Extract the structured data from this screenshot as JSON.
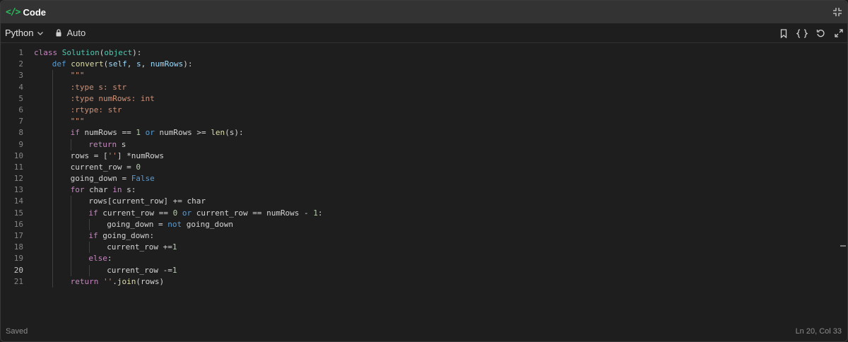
{
  "header": {
    "title": "Code",
    "icon": "code-icon",
    "collapse_icon": "collapse-icon"
  },
  "toolbar": {
    "language": "Python",
    "mode": "Auto",
    "icons": [
      "bookmark-icon",
      "format-braces-icon",
      "reset-icon",
      "expand-icon"
    ]
  },
  "editor": {
    "active_line": 20,
    "lines": [
      {
        "n": "1",
        "indent": 0,
        "tokens": [
          [
            "kw",
            "class"
          ],
          [
            "op",
            " "
          ],
          [
            "cls",
            "Solution"
          ],
          [
            "op",
            "("
          ],
          [
            "cls",
            "object"
          ],
          [
            "op",
            "):"
          ]
        ]
      },
      {
        "n": "2",
        "indent": 1,
        "tokens": [
          [
            "bl",
            "def"
          ],
          [
            "op",
            " "
          ],
          [
            "fn",
            "convert"
          ],
          [
            "op",
            "("
          ],
          [
            "pm",
            "self"
          ],
          [
            "op",
            ", "
          ],
          [
            "pm",
            "s"
          ],
          [
            "op",
            ", "
          ],
          [
            "pm",
            "numRows"
          ],
          [
            "op",
            "):"
          ]
        ]
      },
      {
        "n": "3",
        "indent": 2,
        "tokens": [
          [
            "st",
            "\"\"\""
          ]
        ]
      },
      {
        "n": "4",
        "indent": 2,
        "tokens": [
          [
            "st",
            ":type s: str"
          ]
        ]
      },
      {
        "n": "5",
        "indent": 2,
        "tokens": [
          [
            "st",
            ":type numRows: int"
          ]
        ]
      },
      {
        "n": "6",
        "indent": 2,
        "tokens": [
          [
            "st",
            ":rtype: str"
          ]
        ]
      },
      {
        "n": "7",
        "indent": 2,
        "tokens": [
          [
            "st",
            "\"\"\""
          ]
        ]
      },
      {
        "n": "8",
        "indent": 2,
        "tokens": [
          [
            "kw",
            "if"
          ],
          [
            "op",
            " numRows == "
          ],
          [
            "num",
            "1"
          ],
          [
            "op",
            " "
          ],
          [
            "bl",
            "or"
          ],
          [
            "op",
            " numRows >= "
          ],
          [
            "fn",
            "len"
          ],
          [
            "op",
            "(s):"
          ]
        ]
      },
      {
        "n": "9",
        "indent": 3,
        "tokens": [
          [
            "kw",
            "return"
          ],
          [
            "op",
            " s"
          ]
        ]
      },
      {
        "n": "10",
        "indent": 2,
        "tokens": [
          [
            "op",
            "rows = ["
          ],
          [
            "st",
            "''"
          ],
          [
            "op",
            "] *numRows"
          ]
        ]
      },
      {
        "n": "11",
        "indent": 2,
        "tokens": [
          [
            "op",
            "current_row = "
          ],
          [
            "num",
            "0"
          ]
        ]
      },
      {
        "n": "12",
        "indent": 2,
        "tokens": [
          [
            "op",
            "going_down = "
          ],
          [
            "bl",
            "False"
          ]
        ]
      },
      {
        "n": "13",
        "indent": 2,
        "tokens": [
          [
            "kw",
            "for"
          ],
          [
            "op",
            " char "
          ],
          [
            "kw",
            "in"
          ],
          [
            "op",
            " s:"
          ]
        ]
      },
      {
        "n": "14",
        "indent": 3,
        "tokens": [
          [
            "op",
            "rows[current_row] += char"
          ]
        ]
      },
      {
        "n": "15",
        "indent": 3,
        "tokens": [
          [
            "kw",
            "if"
          ],
          [
            "op",
            " current_row == "
          ],
          [
            "num",
            "0"
          ],
          [
            "op",
            " "
          ],
          [
            "bl",
            "or"
          ],
          [
            "op",
            " current_row == numRows - "
          ],
          [
            "num",
            "1"
          ],
          [
            "op",
            ":"
          ]
        ]
      },
      {
        "n": "16",
        "indent": 4,
        "tokens": [
          [
            "op",
            "going_down = "
          ],
          [
            "bl",
            "not"
          ],
          [
            "op",
            " going_down"
          ]
        ]
      },
      {
        "n": "17",
        "indent": 3,
        "tokens": [
          [
            "kw",
            "if"
          ],
          [
            "op",
            " going_down:"
          ]
        ]
      },
      {
        "n": "18",
        "indent": 4,
        "tokens": [
          [
            "op",
            "current_row +="
          ],
          [
            "num",
            "1"
          ]
        ]
      },
      {
        "n": "19",
        "indent": 3,
        "tokens": [
          [
            "kw",
            "else"
          ],
          [
            "op",
            ":"
          ]
        ]
      },
      {
        "n": "20",
        "indent": 4,
        "tokens": [
          [
            "op",
            "current_row -="
          ],
          [
            "num",
            "1"
          ]
        ]
      },
      {
        "n": "21",
        "indent": 2,
        "tokens": [
          [
            "kw",
            "return"
          ],
          [
            "op",
            " "
          ],
          [
            "st",
            "''"
          ],
          [
            "op",
            "."
          ],
          [
            "fn",
            "join"
          ],
          [
            "op",
            "(rows)"
          ]
        ]
      }
    ]
  },
  "status": {
    "saved": "Saved",
    "position": "Ln 20, Col 33"
  },
  "colors": {
    "accent": "#2cbb5d",
    "background": "#1e1e1e",
    "header": "#333333"
  }
}
